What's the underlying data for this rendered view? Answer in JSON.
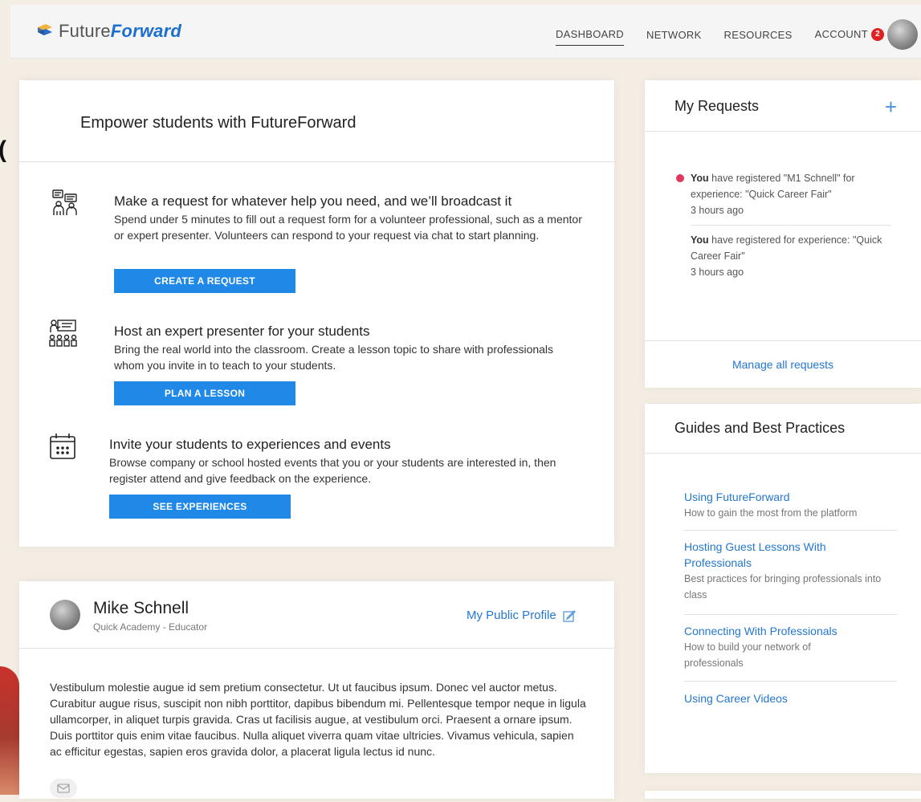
{
  "app": {
    "logo_name": "Future",
    "logo_accent": "Forward"
  },
  "nav": {
    "items": [
      {
        "label": "DASHBOARD",
        "active": true
      },
      {
        "label": "NETWORK",
        "active": false
      },
      {
        "label": "RESOURCES",
        "active": false
      },
      {
        "label": "ACCOUNT",
        "active": false
      }
    ],
    "account_badge": "2"
  },
  "empower": {
    "title": "Empower students with FutureForward",
    "features": [
      {
        "icon": "people-chat-icon",
        "title": "Make a request for whatever help you need, and we’ll broadcast it",
        "description": "Spend under 5 minutes to fill out a request form for a volunteer professional, such as a mentor or expert presenter. Volunteers can respond to your request via chat to start planning.",
        "button": "CREATE A REQUEST"
      },
      {
        "icon": "presenter-icon",
        "title": "Host an expert presenter for your students",
        "description": "Bring the real world into the classroom. Create a lesson topic to share with professionals whom you invite in to teach to your students.",
        "button": "PLAN A LESSON"
      },
      {
        "icon": "calendar-icon",
        "title": "Invite your students to experiences and events",
        "description": "Browse company or school hosted events that you or your students are interested in, then register attend and give feedback on the experience.",
        "button": "SEE EXPERIENCES"
      }
    ]
  },
  "profile": {
    "name": "Mike Schnell",
    "subtitle": "Quick Academy - Educator",
    "public_profile_link": "My Public Profile",
    "bio": "Vestibulum molestie augue id sem pretium consectetur. Ut ut faucibus ipsum. Donec vel auctor metus. Curabitur augue risus, suscipit non nibh porttitor, dapibus bibendum mi. Pellentesque tempor neque in ligula ullamcorper, in aliquet turpis gravida. Cras ut facilisis augue, at vestibulum orci. Praesent a ornare ipsum. Duis porttitor quis enim vitae faucibus. Nulla aliquet viverra quam vitae ultricies. Vivamus vehicula, sapien ac efficitur egestas, sapien eros gravida dolor, a placerat ligula lectus id nunc."
  },
  "requests": {
    "title": "My Requests",
    "add_label": "+",
    "items": [
      {
        "actor": "You",
        "text": " have registered \"M1 Schnell\" for experience: \"Quick Career Fair\"",
        "time": "3 hours ago",
        "unread": true
      },
      {
        "actor": "You",
        "text": " have registered for experience: \"Quick Career Fair\"",
        "time": "3 hours ago",
        "unread": false
      }
    ],
    "manage_link": "Manage all requests"
  },
  "guides": {
    "title": "Guides and Best Practices",
    "items": [
      {
        "title": "Using FutureForward",
        "description": "How to gain the most from the platform"
      },
      {
        "title": "Hosting Guest Lessons With Professionals",
        "description": "Best practices for bringing professionals into class"
      },
      {
        "title": "Connecting With Professionals",
        "description": "How to build your network of professionals"
      },
      {
        "title": "Using Career Videos",
        "description": ""
      }
    ]
  },
  "colors": {
    "accent": "#2088e6",
    "link": "#2477d0",
    "badge": "#e02020",
    "unread_dot": "#e0365c"
  }
}
